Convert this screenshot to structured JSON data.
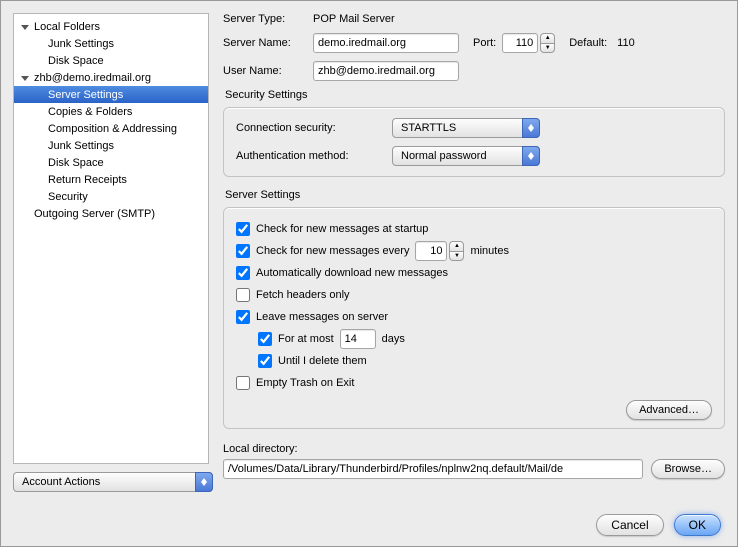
{
  "sidebar": {
    "items": [
      {
        "label": "Local Folders",
        "level": 0,
        "expanded": true
      },
      {
        "label": "Junk Settings",
        "level": 1
      },
      {
        "label": "Disk Space",
        "level": 1
      },
      {
        "label": "zhb@demo.iredmail.org",
        "level": 0,
        "expanded": true
      },
      {
        "label": "Server Settings",
        "level": 1,
        "selected": true
      },
      {
        "label": "Copies & Folders",
        "level": 1
      },
      {
        "label": "Composition & Addressing",
        "level": 1
      },
      {
        "label": "Junk Settings",
        "level": 1
      },
      {
        "label": "Disk Space",
        "level": 1
      },
      {
        "label": "Return Receipts",
        "level": 1
      },
      {
        "label": "Security",
        "level": 1
      },
      {
        "label": "Outgoing Server (SMTP)",
        "level": 0,
        "expanded": false,
        "no_disclosure": true
      }
    ],
    "account_actions_label": "Account Actions"
  },
  "labels": {
    "server_type": "Server Type:",
    "server_name": "Server Name:",
    "port": "Port:",
    "default": "Default:",
    "user_name": "User Name:",
    "security_settings": "Security Settings",
    "connection_security": "Connection security:",
    "auth_method": "Authentication method:",
    "server_settings": "Server Settings",
    "check_startup": "Check for new messages at startup",
    "check_every": "Check for new messages every",
    "minutes": "minutes",
    "auto_download": "Automatically download new messages",
    "fetch_headers": "Fetch headers only",
    "leave_on_server": "Leave messages on server",
    "for_at_most": "For at most",
    "days": "days",
    "until_delete": "Until I delete them",
    "empty_trash": "Empty Trash on Exit",
    "advanced": "Advanced…",
    "local_directory": "Local directory:",
    "browse": "Browse…",
    "cancel": "Cancel",
    "ok": "OK"
  },
  "values": {
    "server_type": "POP Mail Server",
    "server_name": "demo.iredmail.org",
    "port": "110",
    "default_port": "110",
    "user_name": "zhb@demo.iredmail.org",
    "connection_security": "STARTTLS",
    "auth_method": "Normal password",
    "check_interval": "10",
    "leave_days": "14",
    "local_directory": "/Volumes/Data/Library/Thunderbird/Profiles/nplnw2nq.default/Mail/de"
  },
  "checks": {
    "check_startup": true,
    "check_every": true,
    "auto_download": true,
    "fetch_headers": false,
    "leave_on_server": true,
    "for_at_most": true,
    "until_delete": true,
    "empty_trash": false
  }
}
